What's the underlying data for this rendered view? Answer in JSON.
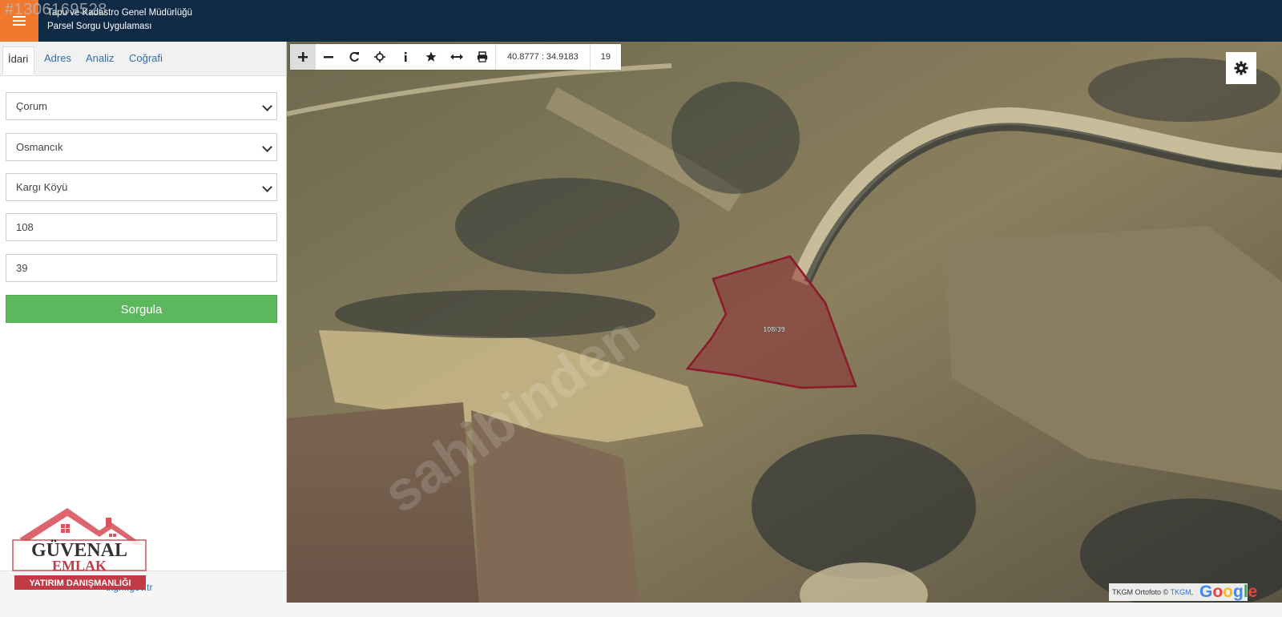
{
  "watermark_id": "#1306169528",
  "header": {
    "title_line1": "Tapu ve Kadastro Genel Müdürlüğü",
    "title_line2": "Parsel Sorgu Uygulaması"
  },
  "tabs": [
    {
      "label": "İdari",
      "active": true
    },
    {
      "label": "Adres",
      "active": false
    },
    {
      "label": "Analiz",
      "active": false
    },
    {
      "label": "Coğrafi",
      "active": false
    }
  ],
  "form": {
    "province": "Çorum",
    "district": "Osmancık",
    "neighborhood": "Kargı Köyü",
    "block": "108",
    "parcel": "39",
    "query_label": "Sorgula"
  },
  "footer": {
    "link": "tkgm.gov.tr"
  },
  "logo": {
    "line1": "GÜVENAL",
    "line2": "EMLAK",
    "line3": "YATIRIM DANIŞMANLIĞI"
  },
  "toolbar": {
    "tools": [
      "zoom-in-icon",
      "zoom-out-icon",
      "refresh-icon",
      "locate-icon",
      "info-icon",
      "star-icon",
      "measure-icon",
      "print-icon"
    ],
    "coordinates": "40.8777 : 34.9183",
    "zoom_level": "19"
  },
  "map": {
    "parcel_label": "108/39",
    "watermark_text": "sahibinden",
    "attribution_prefix": "TKGM Ortofoto ©",
    "attribution_link": "TKGM",
    "google_letters": [
      "G",
      "o",
      "o",
      "g",
      "l",
      "e"
    ],
    "google_colors": [
      "#4285f4",
      "#ea4335",
      "#fbbc05",
      "#4285f4",
      "#34a853",
      "#ea4335"
    ],
    "parcel_color": "#8b1a2b"
  }
}
